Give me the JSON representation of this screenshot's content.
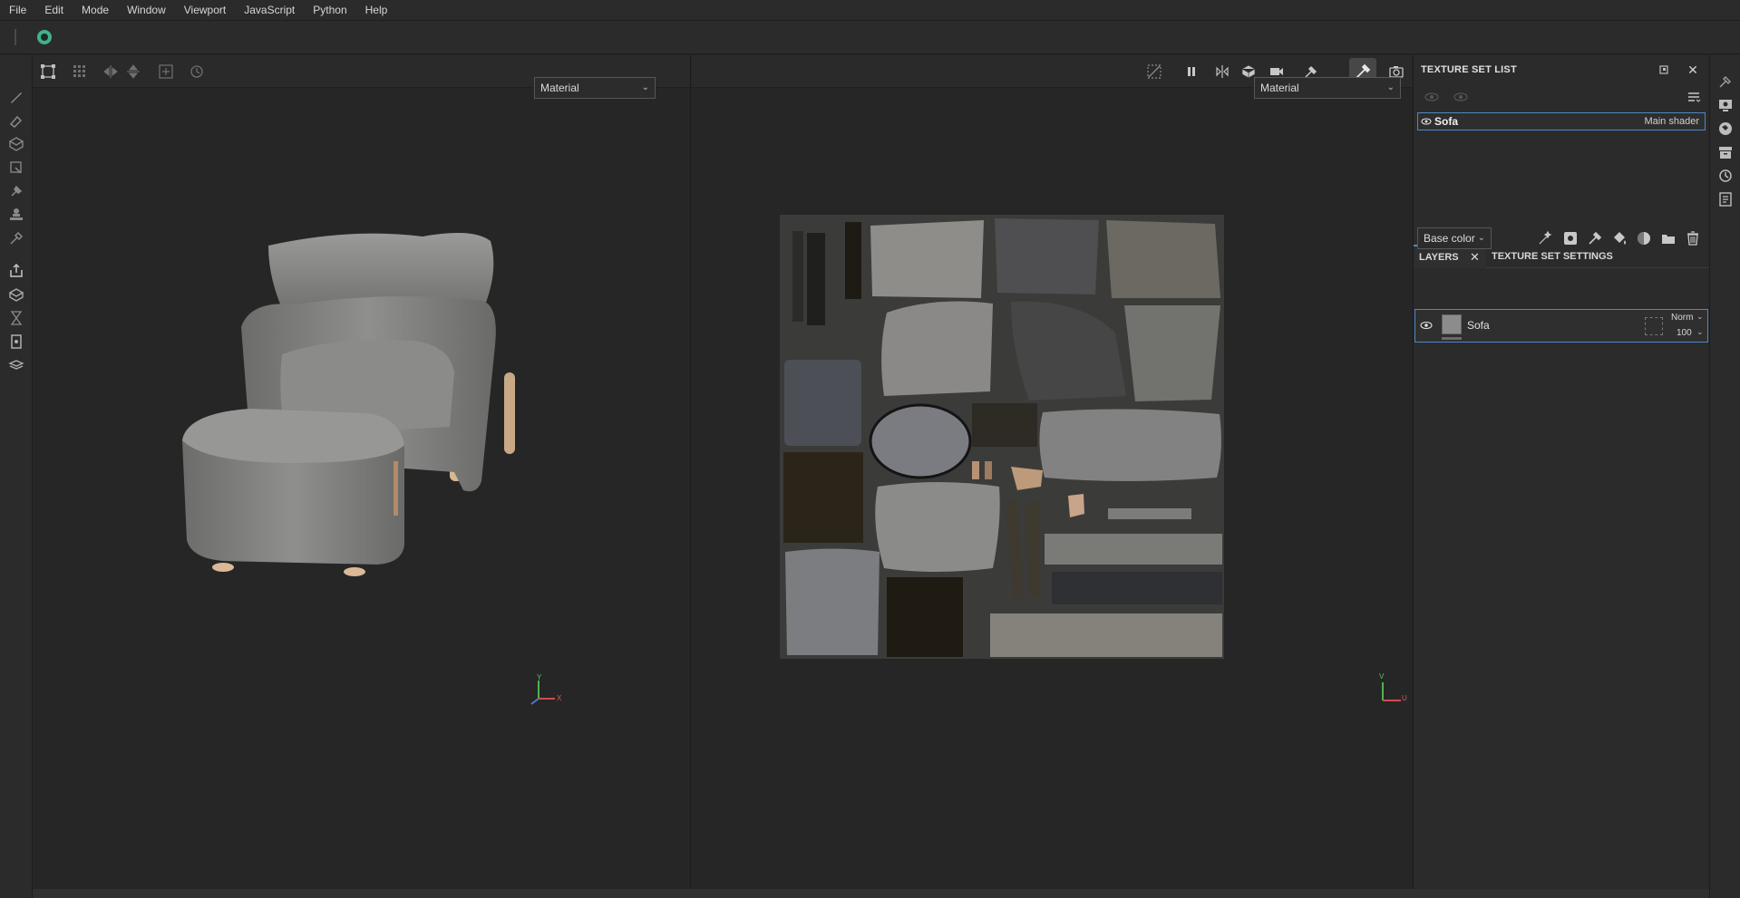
{
  "menu": [
    "File",
    "Edit",
    "Mode",
    "Window",
    "Viewport",
    "JavaScript",
    "Python",
    "Help"
  ],
  "viewport3d": {
    "channel": "Material"
  },
  "viewport2d": {
    "channel": "Material"
  },
  "axes": {
    "left": {
      "y": "Y",
      "x": "X"
    },
    "right": {
      "y": "V",
      "x": "U"
    }
  },
  "texture_set_list": {
    "title": "TEXTURE SET LIST",
    "items": [
      {
        "name": "Sofa",
        "shader": "Main shader"
      }
    ]
  },
  "layers": {
    "tabs": [
      "LAYERS",
      "TEXTURE SET SETTINGS"
    ],
    "channel": "Base color",
    "items": [
      {
        "name": "Sofa",
        "blend": "Norm",
        "opacity": "100"
      }
    ]
  },
  "colors": {
    "accent": "#4f88c8",
    "logo": "#41b28a",
    "background": "#262626"
  },
  "icons": [
    "pencil-icon",
    "eraser-icon",
    "projection-icon",
    "polygon-fill-icon",
    "smudge-icon",
    "clone-icon",
    "color-picker-icon",
    "export-icon",
    "bake-icon",
    "history-icon",
    "camera-icon",
    "pause-icon"
  ]
}
